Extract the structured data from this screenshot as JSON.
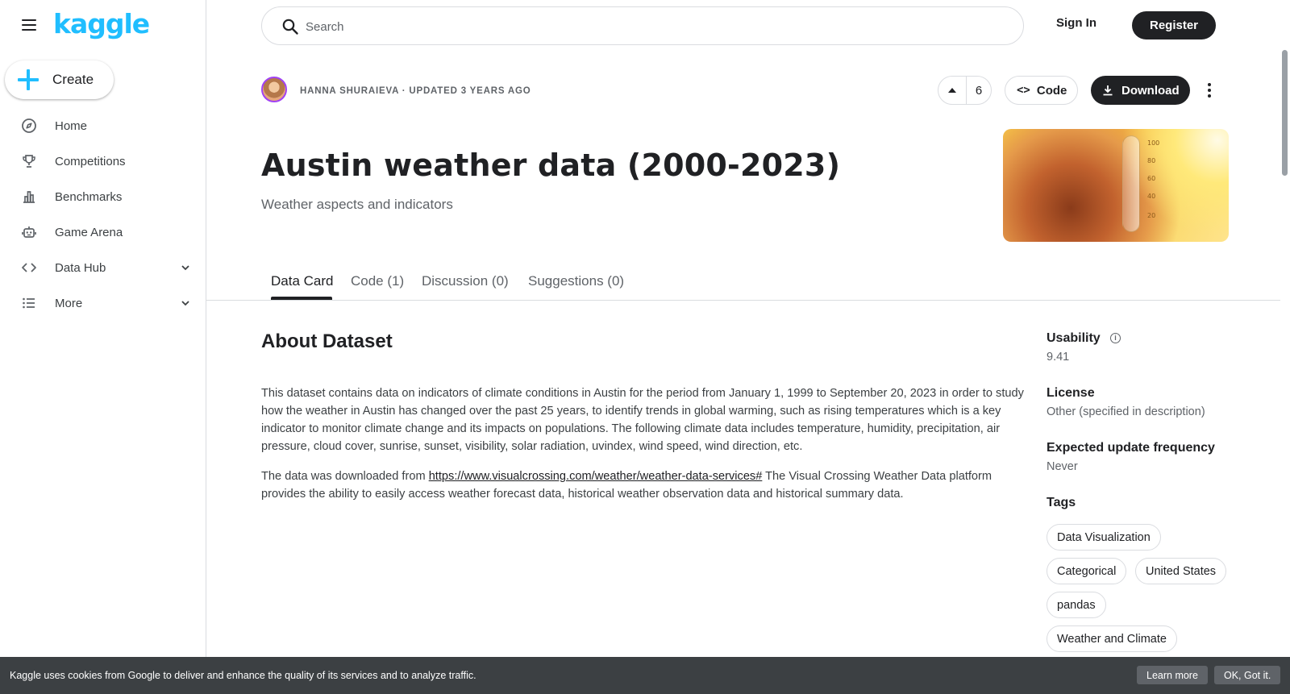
{
  "sidebar": {
    "logo": "kaggle",
    "create_label": "Create",
    "items": [
      {
        "label": "Home",
        "icon": "compass-icon"
      },
      {
        "label": "Competitions",
        "icon": "trophy-icon"
      },
      {
        "label": "Benchmarks",
        "icon": "bar-chart-icon"
      },
      {
        "label": "Game Arena",
        "icon": "robot-icon"
      },
      {
        "label": "Data Hub",
        "icon": "code-brackets-icon"
      },
      {
        "label": "More",
        "icon": "list-icon"
      }
    ]
  },
  "topbar": {
    "search_placeholder": "Search",
    "signin_label": "Sign In",
    "register_label": "Register"
  },
  "dataset": {
    "author_line": "HANNA SHURAIEVA · UPDATED 3 YEARS AGO",
    "upvotes": "6",
    "code_label": "Code",
    "download_label": "Download",
    "title": "Austin weather data (2000-2023)",
    "subtitle": "Weather aspects and indicators",
    "hero_ticks": [
      "100",
      "80",
      "60",
      "40",
      "20"
    ]
  },
  "tabs": [
    "Data Card",
    "Code (1)",
    "Discussion (0)",
    "Suggestions (0)"
  ],
  "about": {
    "heading": "About Dataset",
    "para1": "This dataset contains data on indicators of climate conditions in Austin for the period from January 1, 1999 to September 20, 2023 in order to study how the weather in Austin has changed over the past 25 years, to identify trends in global warming, such as rising temperatures which is a key indicator to monitor climate change and its impacts on populations. The following climate data includes temperature, humidity, precipitation, air pressure, cloud cover, sunrise, sunset, visibility, solar radiation, uvindex, wind speed, wind direction, etc.",
    "para2_prefix": "The data was downloaded from ",
    "para2_link": "https://www.visualcrossing.com/weather/weather-data-services#",
    "para2_suffix": " The Visual Crossing Weather Data platform provides the ability to easily access weather forecast data, historical weather observation data and historical summary data."
  },
  "meta": {
    "usability_label": "Usability",
    "usability_value": "9.41",
    "license_label": "License",
    "license_value": "Other (specified in description)",
    "frequency_label": "Expected update frequency",
    "frequency_value": "Never",
    "tags_label": "Tags",
    "tags": [
      "Data Visualization",
      "Categorical",
      "United States",
      "pandas",
      "Weather and Climate"
    ]
  },
  "cookie": {
    "text": "Kaggle uses cookies from Google to deliver and enhance the quality of its services and to analyze traffic.",
    "learn_more": "Learn more",
    "ok": "OK, Got it."
  },
  "colors": {
    "brand": "#20beff",
    "dark": "#202124",
    "muted": "#5f6368",
    "border": "#dadce0",
    "avatar_ring": "#a142f4"
  }
}
